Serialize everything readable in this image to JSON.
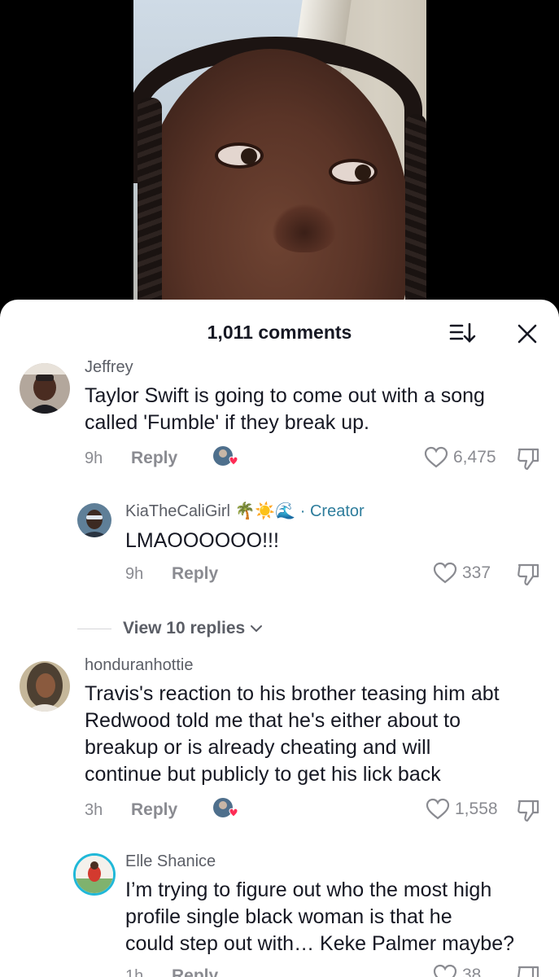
{
  "sheet": {
    "count_label": "1,011 comments"
  },
  "comments": [
    {
      "username": "Jeffrey",
      "text_lines": [
        "Taylor Swift is going to come out with a song",
        "called 'Fumble' if they break up."
      ],
      "time": "9h",
      "reply_label": "Reply",
      "likes": "6,475",
      "creator_liked": true
    },
    {
      "username": "KiaTheCaliGirl 🌴☀️🌊",
      "creator_tag": "· Creator",
      "text_lines": [
        "LMAOOOOOO!!!"
      ],
      "time": "9h",
      "reply_label": "Reply",
      "likes": "337"
    },
    {
      "username": "honduranhottie",
      "text_lines": [
        "Travis's reaction to his brother teasing him abt",
        "Redwood told me that he's either about to",
        "breakup or is already cheating and will",
        "continue but publicly to get his lick back"
      ],
      "time": "3h",
      "reply_label": "Reply",
      "likes": "1,558",
      "creator_liked": true
    },
    {
      "username": "Elle Shanice",
      "text_lines": [
        "I’m trying to figure out who the most high",
        "profile single black woman is that he",
        "could step out with… Keke Palmer maybe?"
      ],
      "time": "1h",
      "reply_label": "Reply",
      "likes": "38"
    }
  ],
  "view_replies_label": "View 10 replies",
  "icons": {
    "sort": "sort-icon",
    "close": "close-icon",
    "heart": "heart-icon",
    "dislike": "thumbs-down-icon",
    "chevron": "chevron-down-icon"
  },
  "colors": {
    "creator_tag": "#2e7d9c",
    "liked_heart": "#fe2c55"
  }
}
